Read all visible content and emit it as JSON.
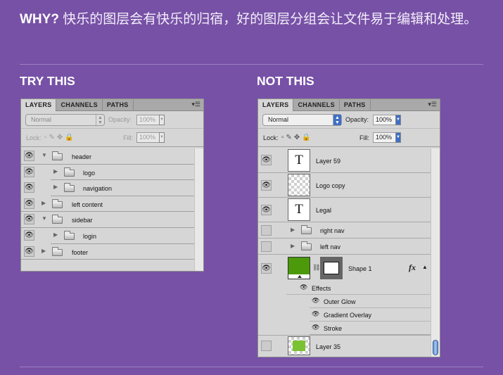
{
  "why": {
    "lead": "WHY?",
    "text": "快乐的图层会有快乐的归宿，好的图层分组会让文件易于编辑和处理。"
  },
  "try_heading": "TRY THIS",
  "not_heading": "NOT THIS",
  "panel": {
    "tabs": [
      "LAYERS",
      "CHANNELS",
      "PATHS"
    ],
    "menu_icon": "▾☰",
    "blend_mode": "Normal",
    "opacity_label": "Opacity:",
    "opacity": "100%",
    "lock_label": "Lock:",
    "fill_label": "Fill:",
    "fill": "100%"
  },
  "try_layers": [
    {
      "name": "header",
      "expand": "▼",
      "indent": 0
    },
    {
      "name": "logo",
      "expand": "▶",
      "indent": 1
    },
    {
      "name": "navigation",
      "expand": "▶",
      "indent": 1
    },
    {
      "name": "left content",
      "expand": "▶",
      "indent": 0
    },
    {
      "name": "sidebar",
      "expand": "▼",
      "indent": 0
    },
    {
      "name": "login",
      "expand": "▶",
      "indent": 1
    },
    {
      "name": "footer",
      "expand": "▶",
      "indent": 0
    }
  ],
  "not_layers": {
    "layer59": "Layer 59",
    "logo_copy": "Logo copy",
    "legal": "Legal",
    "right_nav": "right nav",
    "left_nav": "left nav",
    "shape1": "Shape 1",
    "fx": "fx",
    "effects": "Effects",
    "outer_glow": "Outer Glow",
    "gradient_overlay": "Gradient Overlay",
    "stroke": "Stroke",
    "layer35": "Layer 35",
    "text_thumb": "T",
    "shape_color": "#4c9a0c",
    "layer35_color": "#7ac232"
  }
}
